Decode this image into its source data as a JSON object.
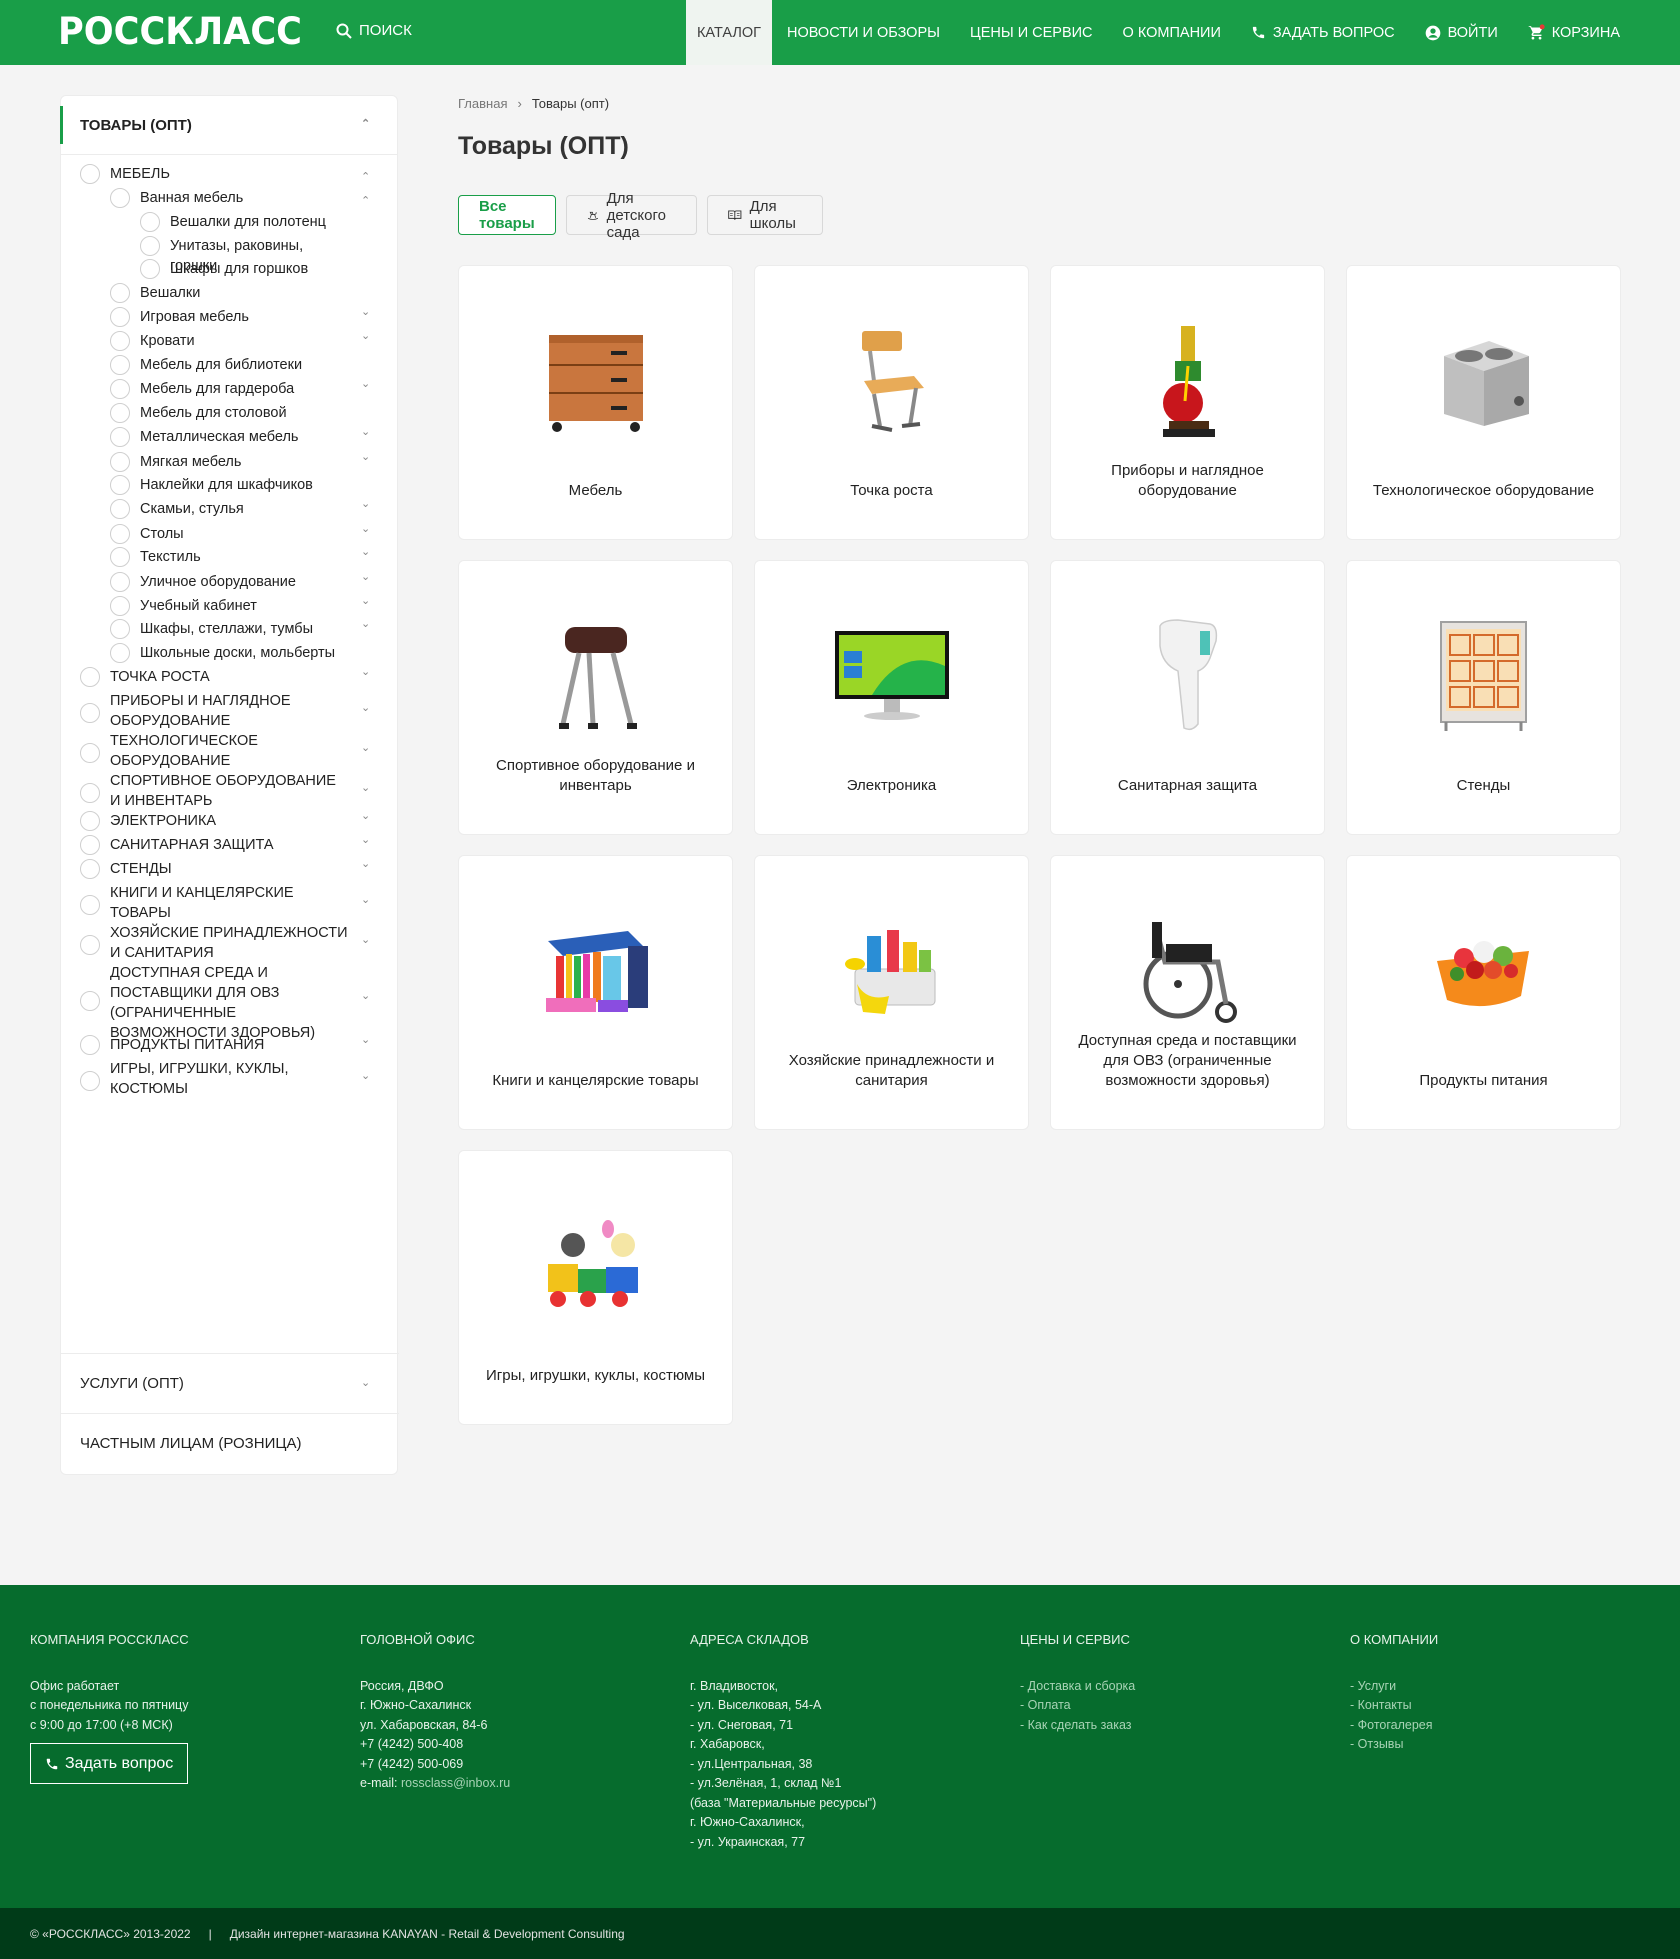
{
  "header": {
    "logo": "РОССКЛАСС",
    "search_label": "ПОИСК",
    "nav": [
      {
        "label": "КАТАЛОГ"
      },
      {
        "label": "НОВОСТИ И ОБЗОРЫ"
      },
      {
        "label": "ЦЕНЫ И СЕРВИС"
      },
      {
        "label": "О КОМПАНИИ"
      },
      {
        "label": "ЗАДАТЬ ВОПРОС",
        "icon": "phone-icon"
      },
      {
        "label": "ВОЙТИ",
        "icon": "user-icon"
      },
      {
        "label": "КОРЗИНА",
        "icon": "cart-icon"
      }
    ]
  },
  "sidebar": {
    "title": "ТОВАРЫ (ОПТ)",
    "items": [
      {
        "label": "МЕБЕЛЬ",
        "level": 0
      },
      {
        "label": "Ванная мебель",
        "level": 1
      },
      {
        "label": "Вешалки для полотенц",
        "level": 2
      },
      {
        "label": "Унитазы, раковины, горшки",
        "level": 2
      },
      {
        "label": "Шкафы для горшков",
        "level": 2
      },
      {
        "label": "Вешалки",
        "level": 1
      },
      {
        "label": "Игровая мебель",
        "level": 1
      },
      {
        "label": "Кровати",
        "level": 1
      },
      {
        "label": "Мебель для библиотеки",
        "level": 1
      },
      {
        "label": "Мебель для гардероба",
        "level": 1
      },
      {
        "label": "Мебель для столовой",
        "level": 1
      },
      {
        "label": "Металлическая мебель",
        "level": 1
      },
      {
        "label": "Мягкая мебель",
        "level": 1
      },
      {
        "label": "Наклейки для шкафчиков",
        "level": 1
      },
      {
        "label": "Скамьи, стулья",
        "level": 1
      },
      {
        "label": "Столы",
        "level": 1
      },
      {
        "label": "Текстиль",
        "level": 1
      },
      {
        "label": "Уличное оборудование",
        "level": 1
      },
      {
        "label": "Учебный кабинет",
        "level": 1
      },
      {
        "label": "Шкафы, стеллажи, тумбы",
        "level": 1
      },
      {
        "label": "Школьные доски, мольберты",
        "level": 1
      },
      {
        "label": "ТОЧКА РОСТА",
        "level": 0
      },
      {
        "label": "ПРИБОРЫ И НАГЛЯДНОЕ ОБОРУДОВАНИЕ",
        "level": 0
      },
      {
        "label": "ТЕХНОЛОГИЧЕСКОЕ ОБОРУДОВАНИЕ",
        "level": 0
      },
      {
        "label": "СПОРТИВНОЕ ОБОРУДОВАНИЕ И ИНВЕНТАРЬ",
        "level": 0
      },
      {
        "label": "ЭЛЕКТРОНИКА",
        "level": 0
      },
      {
        "label": "САНИТАРНАЯ ЗАЩИТА",
        "level": 0
      },
      {
        "label": "СТЕНДЫ",
        "level": 0
      },
      {
        "label": "КНИГИ И КАНЦЕЛЯРСКИЕ ТОВАРЫ",
        "level": 0
      },
      {
        "label": "ХОЗЯЙСКИЕ ПРИНАДЛЕЖНОСТИ И САНИТАРИЯ",
        "level": 0
      },
      {
        "label": "ДОСТУПНАЯ СРЕДА И ПОСТАВЩИКИ ДЛЯ ОВЗ (ОГРАНИЧЕННЫЕ ВОЗМОЖНОСТИ ЗДОРОВЬЯ)",
        "level": 0
      },
      {
        "label": "ПРОДУКТЫ ПИТАНИЯ",
        "level": 0
      },
      {
        "label": "ИГРЫ, ИГРУШКИ, КУКЛЫ, КОСТЮМЫ",
        "level": 0
      }
    ],
    "services": "УСЛУГИ (ОПТ)",
    "retail": "ЧАСТНЫМ ЛИЦАМ (РОЗНИЦА)"
  },
  "breadcrumb": {
    "home": "Главная",
    "current": "Товары (опт)"
  },
  "page_title": "Товары (ОПТ)",
  "filters": [
    "Все товары",
    "Для детского сада",
    "Для школы"
  ],
  "categories": [
    {
      "label": "Мебель",
      "icon": "furniture-icon"
    },
    {
      "label": "Точка роста",
      "icon": "chair-icon"
    },
    {
      "label": "Приборы и наглядное оборудование",
      "icon": "engine-model-icon"
    },
    {
      "label": "Технологическое оборудование",
      "icon": "cooker-icon"
    },
    {
      "label": "Спортивное оборудование и инвентарь",
      "icon": "gym-horse-icon"
    },
    {
      "label": "Электроника",
      "icon": "monitor-icon"
    },
    {
      "label": "Санитарная защита",
      "icon": "thermometer-icon"
    },
    {
      "label": "Стенды",
      "icon": "stand-icon"
    },
    {
      "label": "Книги и канцелярские товары",
      "icon": "stationery-icon"
    },
    {
      "label": "Хозяйские принадлежности и санитария",
      "icon": "cleaning-icon"
    },
    {
      "label": "Доступная среда и поставщики для ОВЗ (ограниченные возможности здоровья)",
      "icon": "wheelchair-icon"
    },
    {
      "label": "Продукты питания",
      "icon": "food-icon"
    },
    {
      "label": "Игры, игрушки, куклы, костюмы",
      "icon": "toys-icon"
    }
  ],
  "footer": {
    "company": {
      "title": "КОМПАНИЯ РОССКЛАСС",
      "lines": [
        "Офис работает",
        "с понедельника по пятницу",
        "с 9:00 до 17:00 (+8 МСК)"
      ],
      "button": "Задать вопрос"
    },
    "office": {
      "title": "ГОЛОВНОЙ ОФИС",
      "lines": [
        "Россия, ДВФО",
        "г. Южно-Сахалинск",
        "ул. Хабаровская, 84-6",
        "+7 (4242) 500-408",
        "+7 (4242) 500-069"
      ],
      "email_label": "e-mail: ",
      "email": "rossclass@inbox.ru"
    },
    "warehouses": {
      "title": "АДРЕСА СКЛАДОВ",
      "lines": [
        "г. Владивосток,",
        "- ул. Выселковая, 54-А",
        "- ул. Снеговая, 71",
        "г. Хабаровск,",
        "- ул.Центральная, 38",
        "- ул.Зелёная, 1, склад №1",
        "(база \"Материальные ресурсы\")",
        "г. Южно-Сахалинск,",
        "- ул. Украинская, 77"
      ]
    },
    "prices": {
      "title": "ЦЕНЫ И СЕРВИС",
      "links": [
        "- Доставка и сборка",
        "- Оплата",
        "- Как сделать заказ"
      ]
    },
    "about": {
      "title": "О КОМПАНИИ",
      "links": [
        "- Услуги",
        "- Контакты",
        "- Фотогалерея",
        "- Отзывы"
      ]
    },
    "copyright": "© «РОССКЛАСС» 2013-2022",
    "separator": "|",
    "design": "Дизайн интернет-магазина KANAYAN - Retail & Development Consulting"
  },
  "colors": {
    "brand": "#199e48",
    "footer": "#066c2d",
    "footer_bottom": "#003b18"
  }
}
